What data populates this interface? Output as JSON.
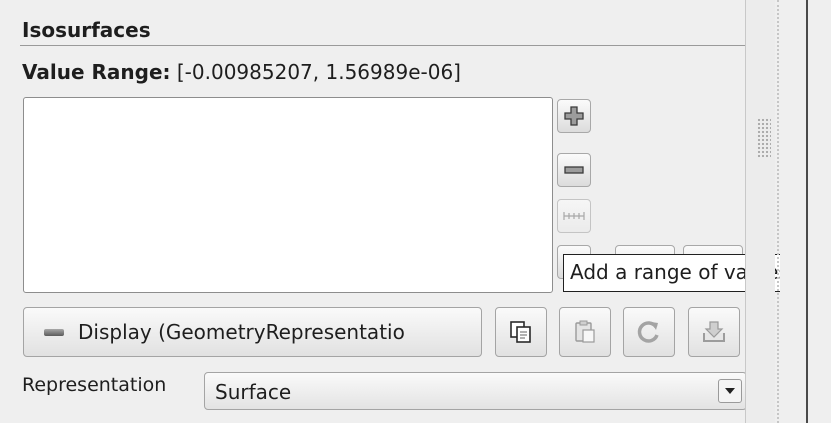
{
  "isosurfaces": {
    "title": "Isosurfaces",
    "value_range_label": "Value Range:",
    "value_range": "[-0.00985207, 1.56989e-06]",
    "values": [],
    "buttons": {
      "add": {
        "icon": "plus-icon"
      },
      "remove": {
        "icon": "minus-icon"
      },
      "add_range": {
        "icon": "range-icon",
        "enabled": false
      }
    },
    "tooltip": "Add a range of values"
  },
  "display": {
    "button_label": "Display (GeometryRepresentatio",
    "toolbar_icons": [
      "copy-icon",
      "paste-icon",
      "reload-icon",
      "save-icon"
    ]
  },
  "representation": {
    "label": "Representation",
    "selected": "Surface"
  }
}
